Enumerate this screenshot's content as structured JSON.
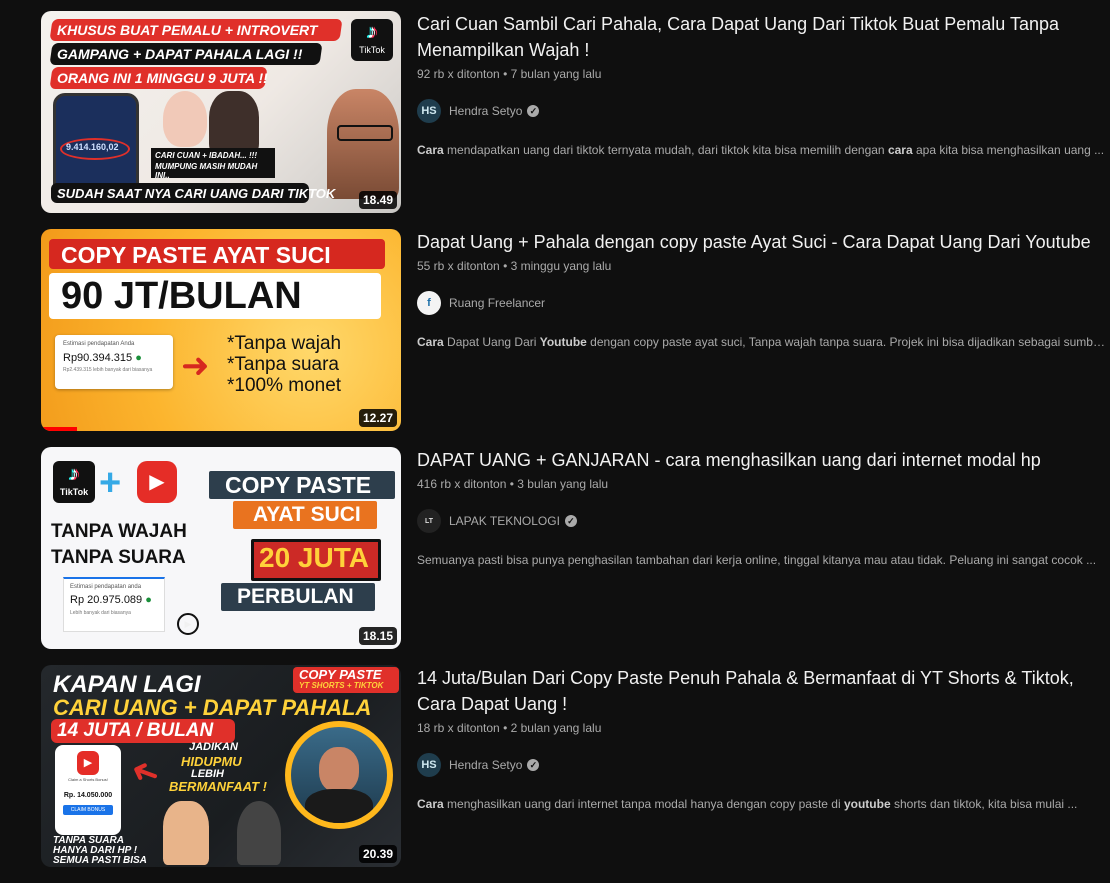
{
  "videos": [
    {
      "title": "Cari Cuan Sambil Cari Pahala, Cara Dapat Uang Dari Tiktok Buat Pemalu Tanpa Menampilkan Wajah !",
      "views": "92 rb x ditonton",
      "age": "7 bulan yang lalu",
      "channel": "Hendra Setyo",
      "verified": true,
      "desc_pre": "Cara",
      "desc_rest": " mendapatkan uang dari tiktok ternyata mudah, dari tiktok kita bisa memilih dengan ",
      "desc_b2": "cara",
      "desc_rest2": " apa kita bisa menghasilkan uang ...",
      "duration": "18.49",
      "thumb": {
        "line1": "KHUSUS BUAT PEMALU + INTROVERT",
        "line2": "GAMPANG + DAPAT PAHALA LAGI !!",
        "line3": "ORANG INI 1 MINGGU 9 JUTA !!",
        "bubble1": "CARI CUAN + IBADAH... !!!",
        "bubble2": "MUMPUNG MASIH MUDAH INI..",
        "bottom": "SUDAH SAAT NYA CARI UANG DARI TIKTOK",
        "badge": "TikTok",
        "phone_amount": "9.414.160,02"
      }
    },
    {
      "title": "Dapat Uang + Pahala dengan copy paste Ayat Suci - Cara Dapat Uang Dari Youtube",
      "views": "55 rb x ditonton",
      "age": "3 minggu yang lalu",
      "channel": "Ruang Freelancer",
      "verified": false,
      "desc_pre": "Cara",
      "desc_rest": " Dapat Uang Dari ",
      "desc_b2": "Youtube",
      "desc_rest2": " dengan copy paste ayat suci, Tanpa wajah tanpa suara. Projek ini bisa dijadikan sebagai sumber ...",
      "duration": "12.27",
      "progress": 0.1,
      "thumb": {
        "line1": "COPY PASTE AYAT SUCI",
        "line2": "90 JT/BULAN",
        "card_label": "Estimasi pendapatan Anda",
        "card_amount": "Rp90.394.315",
        "card_note": "Rp2.439.315 lebih banyak dari biasanya",
        "bullet1": "*Tanpa wajah",
        "bullet2": "*Tanpa suara",
        "bullet3": "*100% monet"
      }
    },
    {
      "title": "DAPAT UANG + GANJARAN - cara menghasilkan uang dari internet modal hp",
      "views": "416 rb x ditonton",
      "age": "3 bulan yang lalu",
      "channel": "LAPAK TEKNOLOGI",
      "verified": true,
      "desc_pre": "",
      "desc_rest": "Semuanya pasti bisa punya penghasilan tambahan dari kerja online, tinggal kitanya mau atau tidak. Peluang ini sangat cocok ...",
      "desc_b2": "",
      "desc_rest2": "",
      "duration": "18.15",
      "thumb": {
        "line1": "TANPA WAJAH",
        "line2": "TANPA SUARA",
        "card_label": "Estimasi pendapatan anda",
        "card_amount": "Rp 20.975.089",
        "card_note": "Lebih banyak dari biasanya",
        "tag1": "COPY PASTE",
        "tag2": "AYAT SUCI",
        "tag3": "20 JUTA",
        "tag4": "PERBULAN",
        "badge": "TikTok"
      }
    },
    {
      "title": "14 Juta/Bulan Dari Copy Paste Penuh Pahala & Bermanfaat di YT Shorts & Tiktok, Cara Dapat Uang !",
      "views": "18 rb x ditonton",
      "age": "2 bulan yang lalu",
      "channel": "Hendra Setyo",
      "verified": true,
      "desc_pre": "Cara",
      "desc_rest": " menghasilkan uang dari internet tanpa modal hanya dengan copy paste di ",
      "desc_b2": "youtube",
      "desc_rest2": " shorts dan tiktok, kita bisa mulai ...",
      "duration": "20.39",
      "thumb": {
        "line1": "KAPAN LAGI",
        "line2": "CARI UANG + DAPAT PAHALA",
        "line3": "14 JUTA / BULAN",
        "corner1": "COPY PASTE",
        "corner2": "YT SHORTS + TIKTOK",
        "mid1": "JADIKAN",
        "mid2": "HIDUPMU",
        "mid3": "LEBIH",
        "mid4": "BERMANFAAT !",
        "card_label": "Claim a Shorts Bonus!",
        "card_amount": "Rp. 14.050.000",
        "card_btn": "CLAIM BONUS",
        "bottom1": "TANPA SUARA",
        "bottom2": "HANYA DARI HP !",
        "bottom3": "SEMUA PASTI BISA"
      }
    }
  ],
  "colors": {
    "background": "#0f0f0f",
    "title": "#f1f1f1",
    "meta": "#aaaaaa",
    "progress": "#ff0000"
  }
}
